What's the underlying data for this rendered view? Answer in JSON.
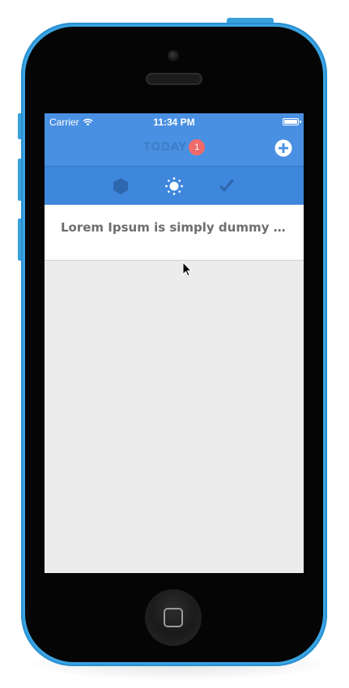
{
  "status_bar": {
    "carrier": "Carrier",
    "time": "11:34 PM",
    "icons": [
      "wifi-icon",
      "battery-icon"
    ]
  },
  "nav": {
    "title": "TODAY",
    "badge_count": "1",
    "add_icon": "plus-circle-icon"
  },
  "toolbar": {
    "items": [
      {
        "icon": "hexagon-icon"
      },
      {
        "icon": "sun-icon"
      },
      {
        "icon": "checkmark-icon"
      }
    ]
  },
  "list": {
    "items": [
      {
        "text": "Lorem Ipsum is simply dummy text of the printing and typesetting industry"
      }
    ]
  },
  "colors": {
    "nav_blue": "#4a90e2",
    "toolbar_blue": "#3f86dd",
    "badge_red": "#ef6b6b",
    "phone_body": "#3aa3e2",
    "screen_background": "#ececec"
  }
}
